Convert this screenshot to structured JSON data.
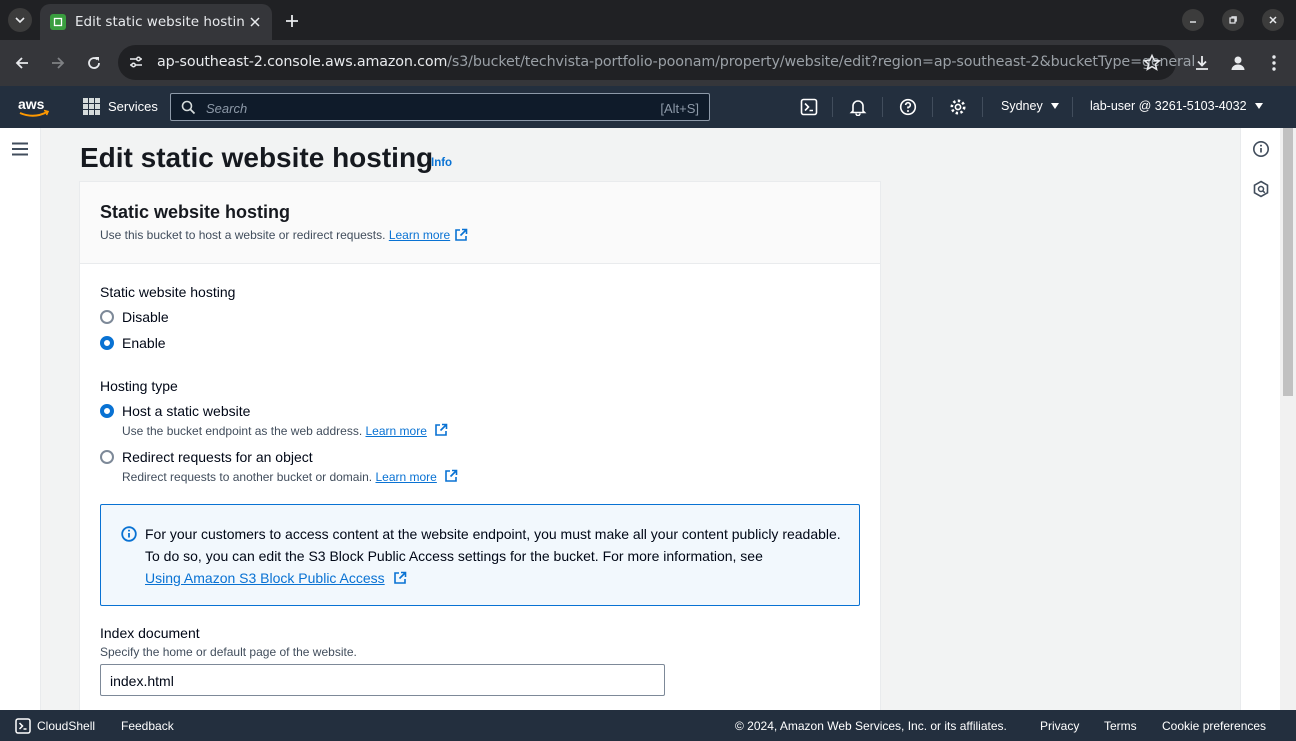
{
  "browser": {
    "tab_title": "Edit static website hosting",
    "url_host": "ap-southeast-2.console.aws.amazon.com",
    "url_path": "/s3/bucket/techvista-portfolio-poonam/property/website/edit?region=ap-southeast-2&bucketType=general"
  },
  "aws_nav": {
    "services_label": "Services",
    "search_placeholder": "Search",
    "search_shortcut": "[Alt+S]",
    "region": "Sydney",
    "account": "lab-user @ 3261-5103-4032"
  },
  "page": {
    "title": "Edit static website hosting",
    "info_link": "Info"
  },
  "panel": {
    "heading": "Static website hosting",
    "description": "Use this bucket to host a website or redirect requests.",
    "learn_more": "Learn more",
    "hosting_label": "Static website hosting",
    "hosting_options": [
      {
        "label": "Disable",
        "selected": false
      },
      {
        "label": "Enable",
        "selected": true
      }
    ],
    "hosting_type_label": "Hosting type",
    "hosting_types": [
      {
        "label": "Host a static website",
        "desc": "Use the bucket endpoint as the web address.",
        "link": "Learn more",
        "selected": true
      },
      {
        "label": "Redirect requests for an object",
        "desc": "Redirect requests to another bucket or domain.",
        "link": "Learn more",
        "selected": false
      }
    ],
    "alert_text": "For your customers to access content at the website endpoint, you must make all your content publicly readable. To do so, you can edit the S3 Block Public Access settings for the bucket. For more information, see",
    "alert_link": "Using Amazon S3 Block Public Access",
    "index_label": "Index document",
    "index_desc": "Specify the home or default page of the website.",
    "index_value": "index.html"
  },
  "footer": {
    "cloudshell": "CloudShell",
    "feedback": "Feedback",
    "copyright": "© 2024, Amazon Web Services, Inc. or its affiliates.",
    "privacy": "Privacy",
    "terms": "Terms",
    "cookies": "Cookie preferences"
  },
  "colors": {
    "aws_nav": "#232f3e",
    "link": "#0972d3",
    "alert_bg": "#f2f8fd"
  }
}
